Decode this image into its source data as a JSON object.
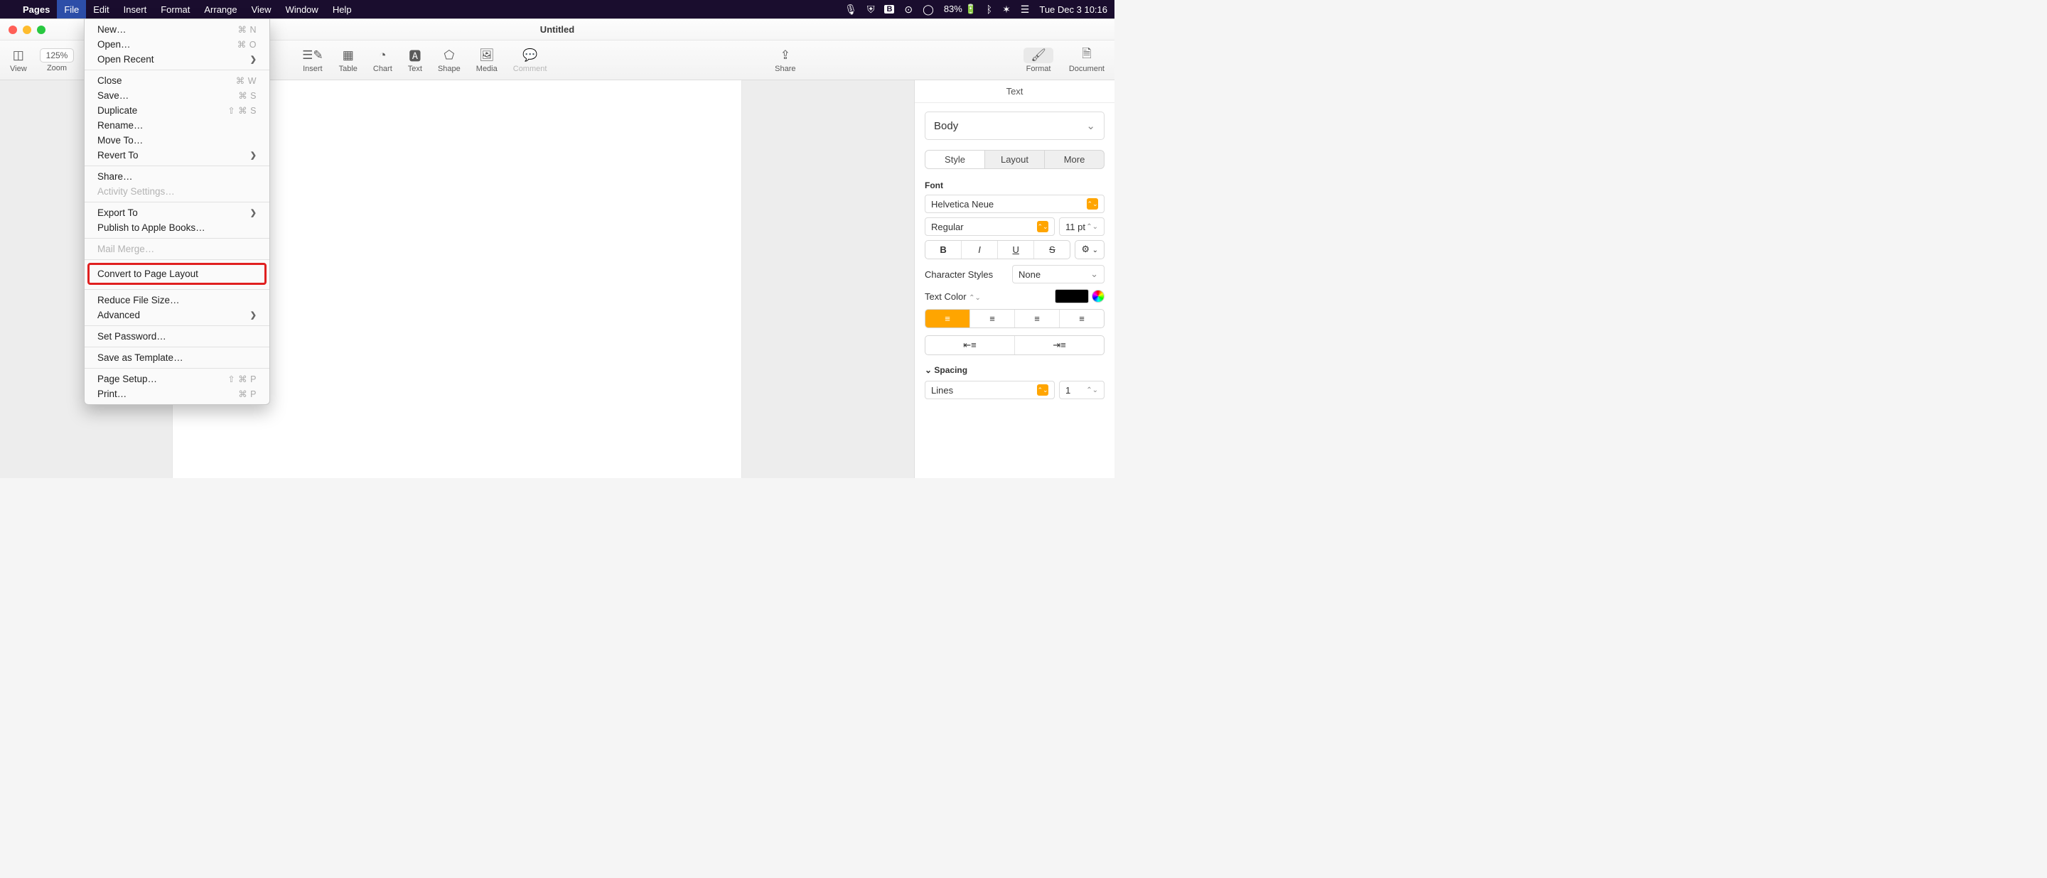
{
  "menubar": {
    "app": "Pages",
    "items": [
      "File",
      "Edit",
      "Insert",
      "Format",
      "Arrange",
      "View",
      "Window",
      "Help"
    ],
    "status": {
      "battery": "83%",
      "datetime": "Tue Dec 3  10:16"
    }
  },
  "window": {
    "title": "Untitled"
  },
  "toolbar": {
    "view": "View",
    "zoom_label": "Zoom",
    "zoom_value": "125%",
    "center": [
      "Insert",
      "Table",
      "Chart",
      "Text",
      "Shape",
      "Media",
      "Comment"
    ],
    "share": "Share",
    "right": [
      "Format",
      "Document"
    ]
  },
  "dropdown": {
    "items": [
      {
        "label": "New…",
        "shortcut": "⌘ N"
      },
      {
        "label": "Open…",
        "shortcut": "⌘ O"
      },
      {
        "label": "Open Recent",
        "submenu": true
      },
      {
        "sep": true
      },
      {
        "label": "Close",
        "shortcut": "⌘ W"
      },
      {
        "label": "Save…",
        "shortcut": "⌘ S"
      },
      {
        "label": "Duplicate",
        "shortcut": "⇧ ⌘ S"
      },
      {
        "label": "Rename…"
      },
      {
        "label": "Move To…"
      },
      {
        "label": "Revert To",
        "submenu": true
      },
      {
        "sep": true
      },
      {
        "label": "Share…"
      },
      {
        "label": "Activity Settings…",
        "disabled": true
      },
      {
        "sep": true
      },
      {
        "label": "Export To",
        "submenu": true
      },
      {
        "label": "Publish to Apple Books…"
      },
      {
        "sep": true
      },
      {
        "label": "Mail Merge…",
        "disabled": true
      },
      {
        "sep": true
      },
      {
        "label": "Convert to Page Layout",
        "highlight": true
      },
      {
        "sep": true
      },
      {
        "label": "Reduce File Size…"
      },
      {
        "label": "Advanced",
        "submenu": true
      },
      {
        "sep": true
      },
      {
        "label": "Set Password…"
      },
      {
        "sep": true
      },
      {
        "label": "Save as Template…"
      },
      {
        "sep": true
      },
      {
        "label": "Page Setup…",
        "shortcut": "⇧ ⌘ P"
      },
      {
        "label": "Print…",
        "shortcut": "⌘ P"
      }
    ]
  },
  "inspector": {
    "header": "Text",
    "paragraph_style": "Body",
    "tabs": [
      "Style",
      "Layout",
      "More"
    ],
    "font_label": "Font",
    "font_family": "Helvetica Neue",
    "font_weight": "Regular",
    "font_size": "11 pt",
    "char_styles_label": "Character Styles",
    "char_styles_value": "None",
    "text_color_label": "Text Color",
    "spacing_label": "Spacing",
    "spacing_mode": "Lines",
    "spacing_value": "1"
  }
}
